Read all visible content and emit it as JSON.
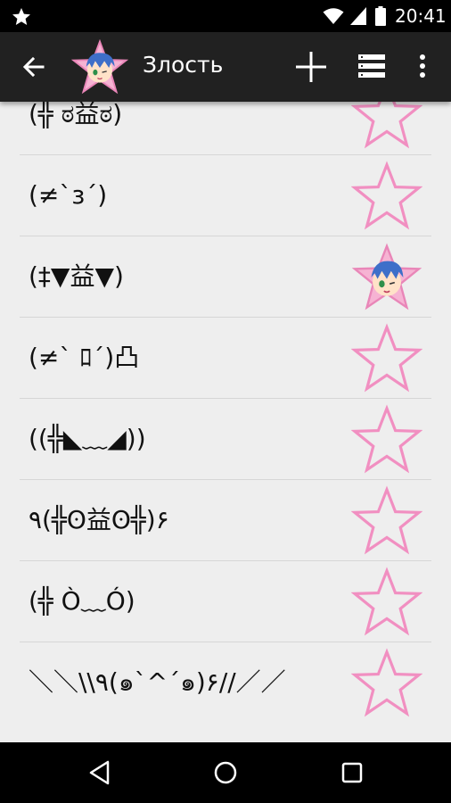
{
  "status_bar": {
    "time": "20:41",
    "icons": [
      "star-notification-icon",
      "wifi-icon",
      "cell-signal-icon",
      "battery-icon"
    ]
  },
  "app_bar": {
    "title": "Злость",
    "actions": [
      "back-arrow-icon",
      "add-icon",
      "list-view-icon",
      "more-options-icon"
    ]
  },
  "items": [
    {
      "text": "(╬ ಠ益ಠ)",
      "favorite": false,
      "partial": true
    },
    {
      "text": "(≠`з´)",
      "favorite": false
    },
    {
      "text": "(‡▼益▼)",
      "favorite": true
    },
    {
      "text": "(≠` ﾛ´)凸",
      "favorite": false
    },
    {
      "text": "((╬◣﹏◢))",
      "favorite": false
    },
    {
      "text": "٩(╬ʘ益ʘ╬)۶",
      "favorite": false
    },
    {
      "text": "(╬ Ò﹏Ó)",
      "favorite": false
    },
    {
      "text": "＼＼\\\\٩(๑`^´๑)۶//／／",
      "favorite": false
    }
  ],
  "colors": {
    "status_bar": "#000000",
    "app_bar": "#212121",
    "background": "#eeeeee",
    "star_outline": "#f18fc1",
    "divider": "#d6d6d6"
  }
}
